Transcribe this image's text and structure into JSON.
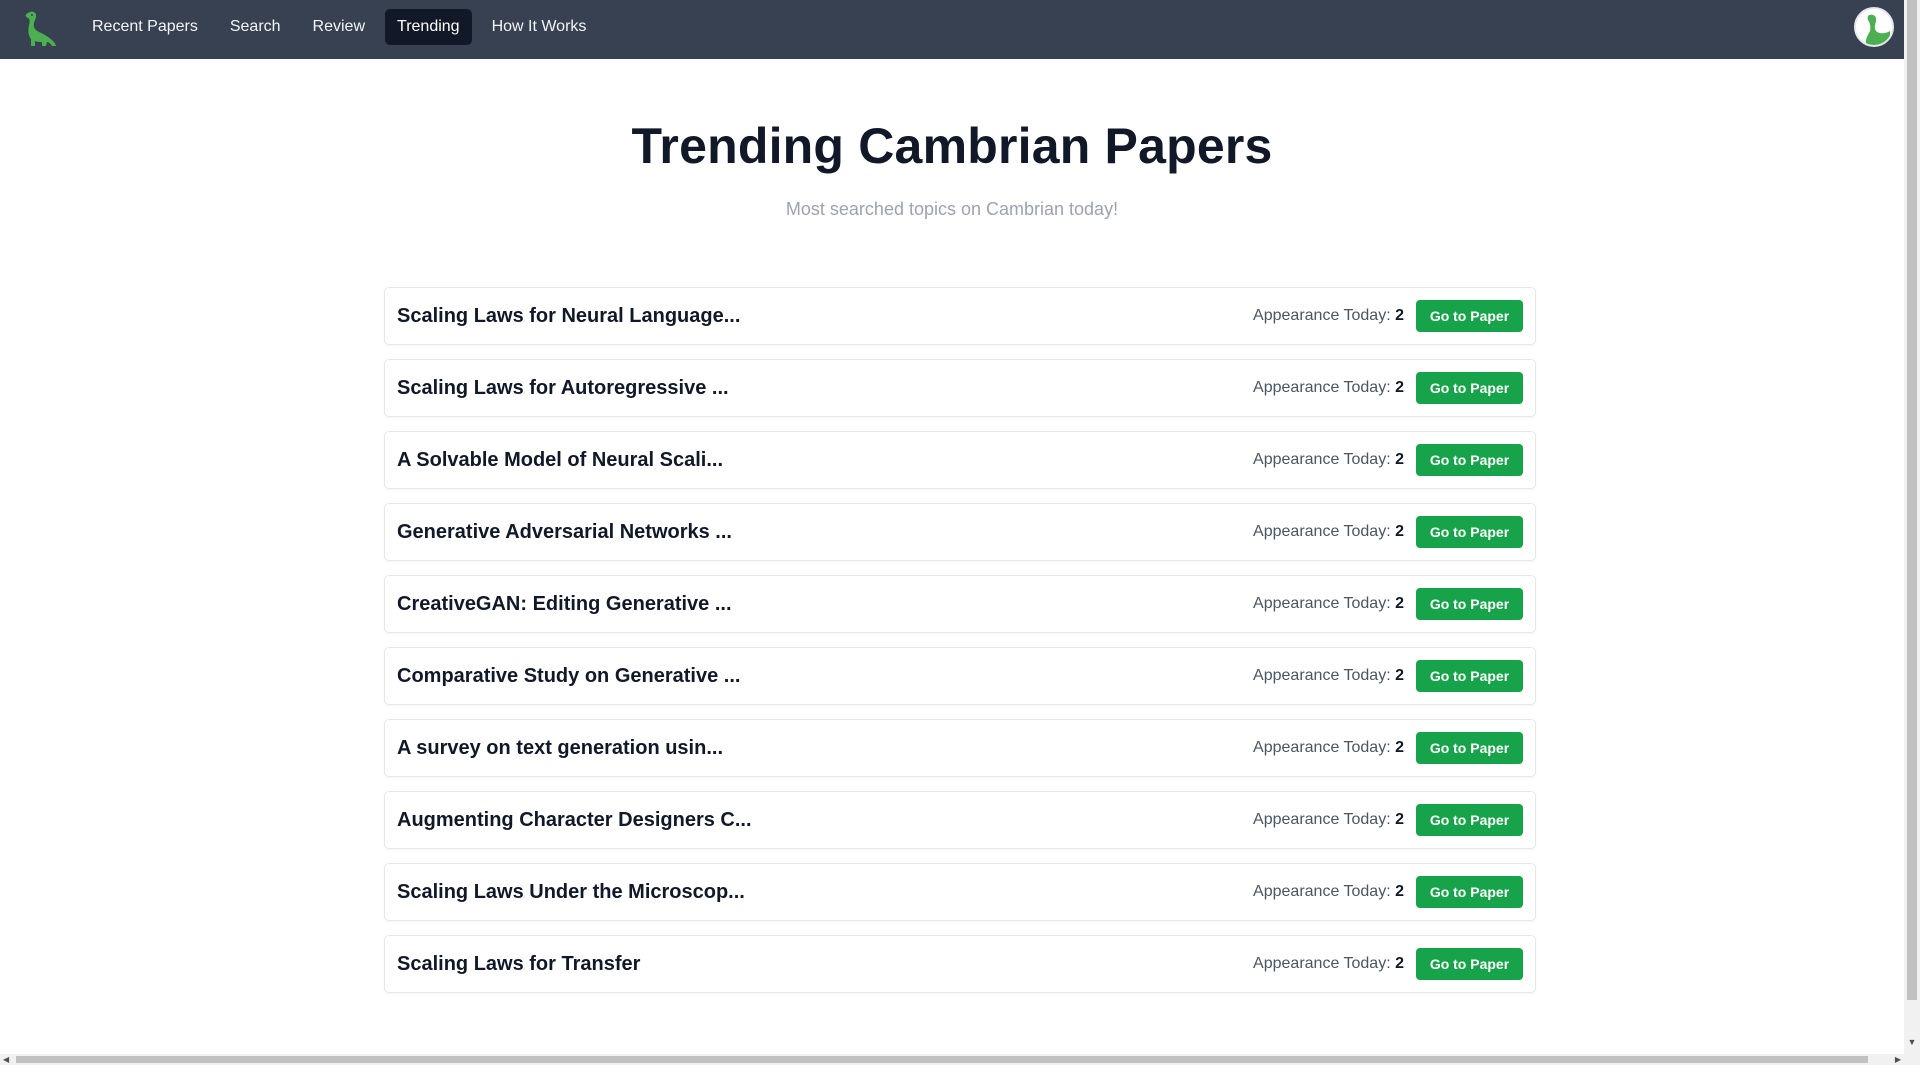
{
  "nav": {
    "logo_icon": "dinosaur-logo-icon",
    "links": [
      {
        "label": "Recent Papers",
        "active": false
      },
      {
        "label": "Search",
        "active": false
      },
      {
        "label": "Review",
        "active": false
      },
      {
        "label": "Trending",
        "active": true
      },
      {
        "label": "How It Works",
        "active": false
      }
    ],
    "avatar_icon": "user-avatar-icon"
  },
  "header": {
    "title": "Trending Cambrian Papers",
    "subtitle": "Most searched topics on Cambrian today!"
  },
  "papers": [
    {
      "title": "Scaling Laws for Neural Language...",
      "appearance_label": "Appearance Today:",
      "count": "2",
      "button": "Go to Paper"
    },
    {
      "title": "Scaling Laws for Autoregressive ...",
      "appearance_label": "Appearance Today:",
      "count": "2",
      "button": "Go to Paper"
    },
    {
      "title": "A Solvable Model of Neural Scali...",
      "appearance_label": "Appearance Today:",
      "count": "2",
      "button": "Go to Paper"
    },
    {
      "title": "Generative Adversarial Networks ...",
      "appearance_label": "Appearance Today:",
      "count": "2",
      "button": "Go to Paper"
    },
    {
      "title": "CreativeGAN: Editing Generative ...",
      "appearance_label": "Appearance Today:",
      "count": "2",
      "button": "Go to Paper"
    },
    {
      "title": "Comparative Study on Generative ...",
      "appearance_label": "Appearance Today:",
      "count": "2",
      "button": "Go to Paper"
    },
    {
      "title": "A survey on text generation usin...",
      "appearance_label": "Appearance Today:",
      "count": "2",
      "button": "Go to Paper"
    },
    {
      "title": "Augmenting Character Designers C...",
      "appearance_label": "Appearance Today:",
      "count": "2",
      "button": "Go to Paper"
    },
    {
      "title": "Scaling Laws Under the Microscop...",
      "appearance_label": "Appearance Today:",
      "count": "2",
      "button": "Go to Paper"
    },
    {
      "title": "Scaling Laws for Transfer",
      "appearance_label": "Appearance Today:",
      "count": "2",
      "button": "Go to Paper"
    }
  ],
  "colors": {
    "navbar": "#374151",
    "active_tab": "#111827",
    "button": "#16a34a",
    "logo": "#4caf50"
  }
}
